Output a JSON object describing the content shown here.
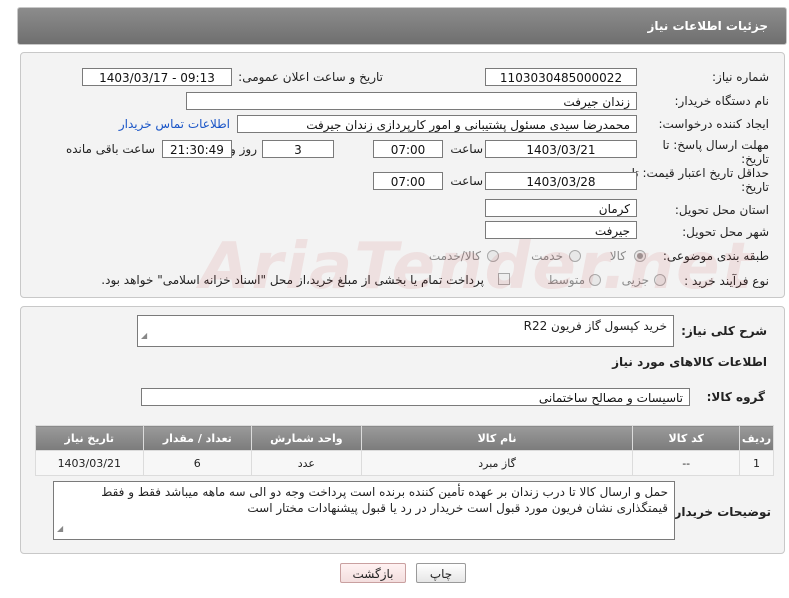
{
  "header": {
    "title": "جزئیات اطلاعات نیاز"
  },
  "form": {
    "need_number_label": "شماره نیاز:",
    "need_number": "1103030485000022",
    "announce_label": "تاریخ و ساعت اعلان عمومی:",
    "announce_value": "1403/03/17 - 09:13",
    "buyer_org_label": "نام دستگاه خریدار:",
    "buyer_org": "زندان جیرفت",
    "creator_label": "ایجاد کننده درخواست:",
    "creator": "محمدرضا سیدی مسئول پشتیبانی و امور کارپردازی زندان جیرفت",
    "contact_link": "اطلاعات تماس خریدار",
    "reply_deadline_label": "مهلت ارسال پاسخ: تا تاریخ:",
    "reply_date": "1403/03/21",
    "time_label": "ساعت",
    "reply_time": "07:00",
    "days_value": "3",
    "days_label": "روز و",
    "remaining_value": "21:30:49",
    "remaining_label": "ساعت باقی مانده",
    "price_validity_label": "حداقل تاریخ اعتبار قیمت: تا تاریخ:",
    "validity_date": "1403/03/28",
    "validity_time": "07:00",
    "province_label": "استان محل تحویل:",
    "province": "کرمان",
    "city_label": "شهر محل تحویل:",
    "city": "جیرفت",
    "category_label": "طبقه بندی موضوعی:",
    "category_options": [
      "کالا",
      "خدمت",
      "کالا/خدمت"
    ],
    "process_label": "نوع فرآیند خرید :",
    "process_options": [
      "جزیی",
      "متوسط"
    ],
    "payment_note": "پرداخت تمام یا بخشی از مبلغ خرید،از محل \"اسناد خزانه اسلامی\" خواهد بود."
  },
  "description": {
    "label": "شرح کلی نیاز:",
    "value": "خرید کپسول گاز فریون R22"
  },
  "goods_info_title": "اطلاعات کالاهای مورد نیاز",
  "goods_group": {
    "label": "گروه کالا:",
    "value": "تاسیسات و مصالح ساختمانی"
  },
  "table": {
    "headers": [
      "ردیف",
      "کد کالا",
      "نام کالا",
      "واحد شمارش",
      "تعداد / مقدار",
      "تاریخ نیاز"
    ],
    "rows": [
      [
        "1",
        "--",
        "گاز مبرد",
        "عدد",
        "6",
        "1403/03/21"
      ]
    ]
  },
  "buyer_notes": {
    "label": "توضیحات خریدار:",
    "value": "حمل و ارسال کالا تا درب زندان بر عهده تأمین کننده برنده است پرداخت وجه دو الی سه ماهه میباشد فقط و فقط قیمتگذاری نشان فریون مورد قبول است خریدار در رد یا قبول پیشنهادات مختار است"
  },
  "buttons": {
    "print": "چاپ",
    "back": "بازگشت"
  },
  "watermark": "AriaTender.net"
}
